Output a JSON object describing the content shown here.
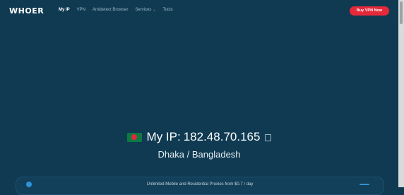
{
  "header": {
    "logo": "WHOER",
    "nav": [
      {
        "label": "My IP"
      },
      {
        "label": "VPN"
      },
      {
        "label": "Antidetect Browser"
      },
      {
        "label": "Services"
      },
      {
        "label": "Tools"
      }
    ],
    "services_chevron": "⌄",
    "cta_label": "Buy VPN Now"
  },
  "main": {
    "ip_label": "My IP:",
    "ip_value": "182.48.70.165",
    "location": "Dhaka / Bangladesh"
  },
  "banner": {
    "text": "Unlimited Mobile and Residential Proxies from $0.7 / day"
  },
  "colors": {
    "background": "#0f3a52",
    "cta": "#e5283a",
    "flag_green": "#0d7a43",
    "flag_red": "#e2273b",
    "accent": "#2f93d6"
  },
  "icons": [
    "bangladesh-flag-icon",
    "copy-icon",
    "chevron-down-icon",
    "info-icon"
  ]
}
